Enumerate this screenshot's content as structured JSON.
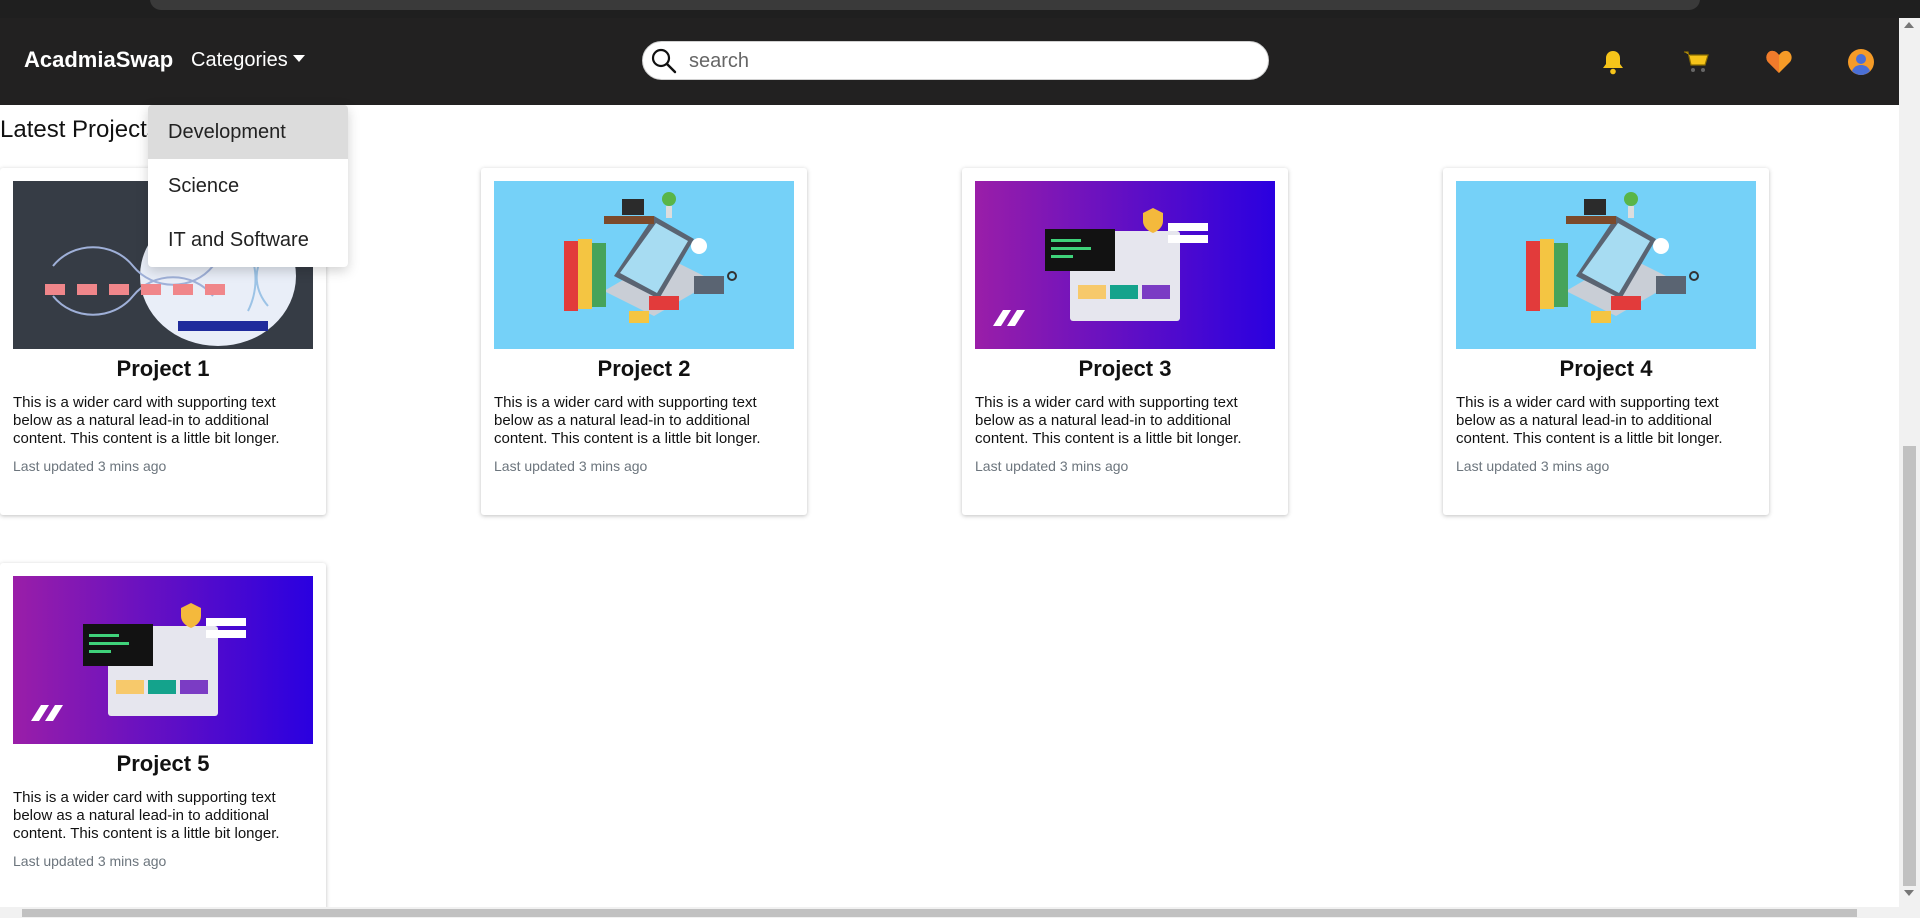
{
  "navbar": {
    "brand": "AcadmiaSwap",
    "categories_label": "Categories",
    "search_placeholder": "search",
    "icons": [
      "bell-icon",
      "cart-icon",
      "heart-icon",
      "user-avatar-icon"
    ],
    "bg_color": "#222121"
  },
  "dropdown": {
    "items": [
      {
        "label": "Development",
        "active": true
      },
      {
        "label": "Science",
        "active": false
      },
      {
        "label": "IT and Software",
        "active": false
      }
    ]
  },
  "section_title": "Latest Projects",
  "cards": [
    {
      "title": "Project 1",
      "image": "workflow-diagram-dark",
      "text": "This is a wider card with supporting text below as a natural lead-in to additional content. This content is a little bit longer.",
      "meta": "Last updated 3 mins ago"
    },
    {
      "title": "Project 2",
      "image": "isometric-laptop-desk",
      "text": "This is a wider card with supporting text below as a natural lead-in to additional content. This content is a little bit longer.",
      "meta": "Last updated 3 mins ago"
    },
    {
      "title": "Project 3",
      "image": "purple-web-security",
      "text": "This is a wider card with supporting text below as a natural lead-in to additional content. This content is a little bit longer.",
      "meta": "Last updated 3 mins ago"
    },
    {
      "title": "Project 4",
      "image": "isometric-laptop-desk",
      "text": "This is a wider card with supporting text below as a natural lead-in to additional content. This content is a little bit longer.",
      "meta": "Last updated 3 mins ago"
    },
    {
      "title": "Project 5",
      "image": "purple-web-security",
      "text": "This is a wider card with supporting text below as a natural lead-in to additional content. This content is a little bit longer.",
      "meta": "Last updated 3 mins ago"
    }
  ],
  "colors": {
    "bell": "#f6c41a",
    "cart": "#f6c41a",
    "heart": "#f59b27",
    "avatar": "#f59b27"
  }
}
